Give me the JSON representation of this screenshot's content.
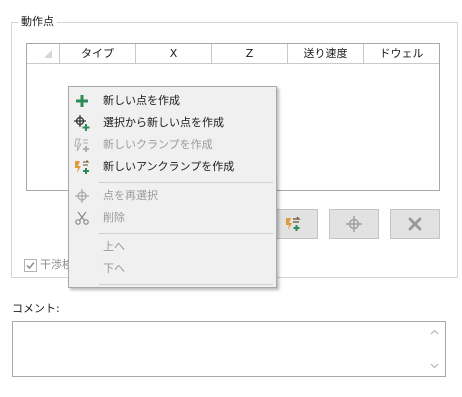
{
  "group": {
    "title": "動作点",
    "grid": {
      "columns": [
        "",
        "タイプ",
        "X",
        "Z",
        "送り速度",
        "ドウェル"
      ]
    }
  },
  "buttons": {
    "anchor_icon": "new-anchor-clamp-icon",
    "reselect_icon": "crosshair-icon",
    "delete_icon": "delete-x-icon"
  },
  "checkbox": {
    "label": "干渉検",
    "checked": true
  },
  "comment": {
    "label": "コメント:",
    "value": ""
  },
  "context_menu": {
    "items": [
      {
        "label": "新しい点を作成",
        "icon": "plus-icon",
        "enabled": true
      },
      {
        "label": "選択から新しい点を作成",
        "icon": "point-from-selection-icon",
        "enabled": true
      },
      {
        "label": "新しいクランプを作成",
        "icon": "new-clamp-icon",
        "enabled": false
      },
      {
        "label": "新しいアンクランプを作成",
        "icon": "new-unclamp-icon",
        "enabled": true
      },
      {
        "label": "点を再選択",
        "icon": "crosshair-icon",
        "enabled": false
      },
      {
        "label": "削除",
        "icon": "scissors-icon",
        "enabled": false
      },
      {
        "label": "上へ",
        "icon": "",
        "enabled": false
      },
      {
        "label": "下へ",
        "icon": "",
        "enabled": false
      }
    ]
  },
  "colors": {
    "accent_green": "#2e8b57",
    "accent_orange": "#e09b3d",
    "disabled_text": "#9a9a9a",
    "menu_background": "#f0f0f0"
  }
}
